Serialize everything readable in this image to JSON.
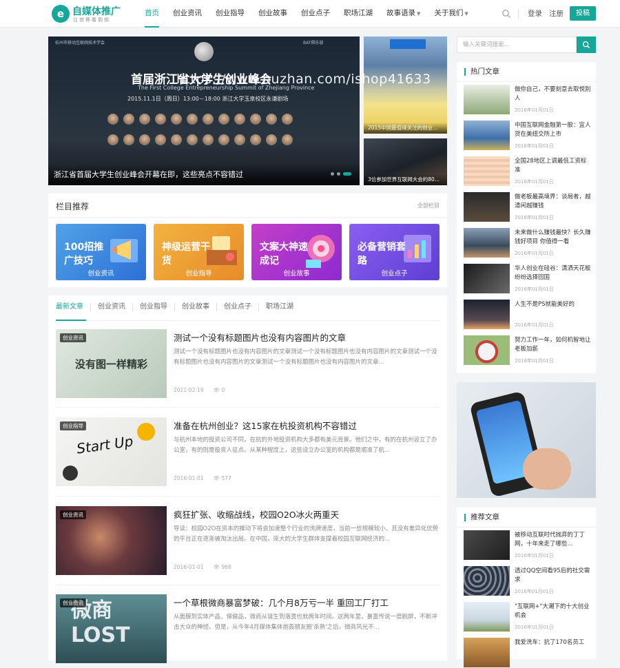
{
  "header": {
    "logo_title": "自媒体推广",
    "logo_sub": "让世界看到你",
    "nav": [
      {
        "label": "首页",
        "active": true
      },
      {
        "label": "创业资讯"
      },
      {
        "label": "创业指导"
      },
      {
        "label": "创业故事"
      },
      {
        "label": "创业点子"
      },
      {
        "label": "职场江湖"
      },
      {
        "label": "故事语录",
        "dropdown": true
      },
      {
        "label": "关于我们",
        "dropdown": true
      }
    ],
    "login": "登录",
    "register": "注册",
    "post": "投稿",
    "search_icon": "search-icon"
  },
  "slider": {
    "banner_cn": "首届浙江省大学生创业峰会",
    "banner_en": "The First College Entrepreneurship Summit of Zhejiang Province",
    "banner_date": "2015.11.1日（周日）13:00－18:00   浙江大学玉泉校区永谦剧场",
    "small_left": "杭州市移动互联网技术学会",
    "small_right": "BAT俱乐部",
    "title": "浙江省首届大学生创业峰会开幕在即，这些亮点不容错过",
    "side": [
      {
        "title": "2015中国最值得关注的创业..."
      },
      {
        "title": "3位参加世界互联网大会的80..."
      }
    ],
    "watermark": "https://www.huzhan.com/ishop41633"
  },
  "columns": {
    "heading": "栏目推荐",
    "more": "全部栏目",
    "items": [
      {
        "big": "100招推广技巧",
        "label": "创业资讯"
      },
      {
        "big": "神级运营干货",
        "label": "创业指导"
      },
      {
        "big": "文案大神速成记",
        "label": "创业故事"
      },
      {
        "big": "必备营销套路",
        "label": "创业点子"
      }
    ]
  },
  "list": {
    "tabs": [
      "最新文章",
      "创业资讯",
      "创业指导",
      "创业故事",
      "创业点子",
      "职场江湖"
    ],
    "articles": [
      {
        "badge": "创业资讯",
        "img_text": "没有图一样精彩",
        "title": "测试一个没有标题图片也没有内容图片的文章",
        "desc": "测试一个没有标题图片也没有内容图片的文章测试一个没有标题图片也没有内容图片的文章测试一个没有标题图片也没有内容图片的文章测试一个没有标题图片也没有内容图片的文章...",
        "date": "2021-02-19",
        "views": "0"
      },
      {
        "badge": "创业指导",
        "img_text": "Start Up",
        "title": "准备在杭州创业？这15家在杭投资机构不容错过",
        "desc": "与杭州本地的投资公司不同，在杭的外地投资机构大多都有美元背景。他们之中，有的在杭州设立了办公室，有的则是投资人驻点。从某种程度上，这些设立办公室的机构都是顺准了杭...",
        "date": "2016-01-01",
        "views": "577"
      },
      {
        "badge": "创业资讯",
        "img_text": "",
        "title": "疯狂扩张、收缩战线，校园O2O冰火两重天",
        "desc": "导读：校园O2O在资本的推动下将会加速整个行业的洗牌速度，当前一些规模较小、且没有差异化优势的平台正在逐渐被淘汰出局。在中国，庞大的大学生群体支撑着校园互联网经济的...",
        "date": "2016-01-01",
        "views": "968"
      },
      {
        "badge": "创业资讯",
        "img_text": "微商 LOST",
        "title": "一个草根微商暴富梦破：几个月8万亏一半 重回工厂打工",
        "desc": "从面膜到实体产品、保健品，微商从诞生到落寞也就两年时间。这两年里，暴富传说一度刷屏，不断冲击大众的神经。但是，从今年4月媒体集体炮轰朋友圈'杀熟'之后，微商风光不...",
        "date": "",
        "views": ""
      }
    ]
  },
  "sidebar": {
    "search_placeholder": "输入关键词搜索...",
    "hot_heading": "热门文章",
    "hot": [
      {
        "title": "做你自己，不要刻意去取悦别人",
        "date": "2016年01月01日"
      },
      {
        "title": "中国互联网金融第一股：宜人贷在美纽交所上市",
        "date": "2016年01月01日"
      },
      {
        "title": "全国28地区上调最低工资标准",
        "date": "2016年01月01日"
      },
      {
        "title": "做老板最高境界：谈局者，越清闲越赚钱",
        "date": "2016年01月01日"
      },
      {
        "title": "未来做什么赚钱最快？长久赚钱好项目 你值得一看",
        "date": "2016年01月01日"
      },
      {
        "title": "华人创业在硅谷：潇洒天花板 纷纷选择回国",
        "date": "2016年01月01日"
      },
      {
        "title": "人生不是PS就能美好的",
        "date": "2016年01月01日"
      },
      {
        "title": "努力工作一年，如何机智地让老板加薪",
        "date": "2016年01月01日"
      }
    ],
    "rec_heading": "推荐文章",
    "rec": [
      {
        "title": "被移动互联时代抛弃的丁丁网，十年来走了哪些...",
        "date": "2016年01月01日"
      },
      {
        "title": "透过QQ空间看95后的社交需求",
        "date": "2016年01月01日"
      },
      {
        "title": "\"互联网+\"大潮下的十大创业机会",
        "date": "2016年01月01日"
      },
      {
        "title": "我爱洗车：抗了170名员工",
        "date": ""
      }
    ]
  }
}
